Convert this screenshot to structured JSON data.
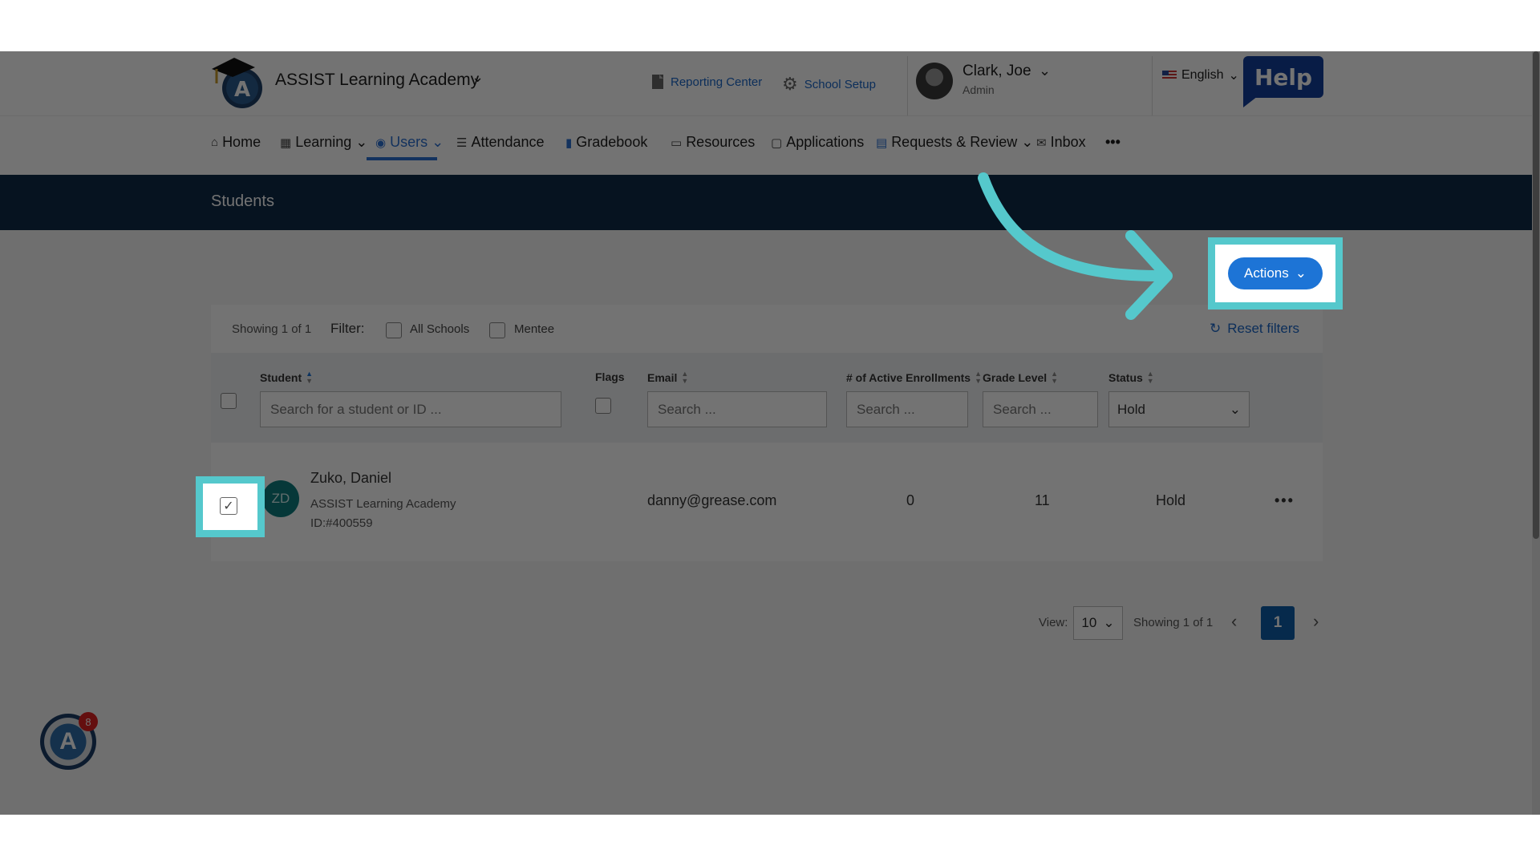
{
  "header": {
    "school_name": "ASSIST Learning Academy",
    "reporting_center": "Reporting Center",
    "school_setup": "School Setup",
    "user_name": "Clark, Joe",
    "user_role": "Admin",
    "language": "English",
    "help": "Help"
  },
  "nav": {
    "items": [
      {
        "label": "Home",
        "icon": "house-icon"
      },
      {
        "label": "Learning",
        "icon": "grid-icon"
      },
      {
        "label": "Users",
        "icon": "user-circle-icon"
      },
      {
        "label": "Attendance",
        "icon": "bars-icon"
      },
      {
        "label": "Gradebook",
        "icon": "book-icon"
      },
      {
        "label": "Resources",
        "icon": "inbox-tray-icon"
      },
      {
        "label": "Applications",
        "icon": "chat-icon"
      },
      {
        "label": "Requests & Review",
        "icon": "clipboard-icon"
      },
      {
        "label": "Inbox",
        "icon": "envelope-icon"
      },
      {
        "label": "•••",
        "icon": "more-icon"
      }
    ],
    "active": "Users"
  },
  "page": {
    "title": "Students",
    "actions_label": "Actions"
  },
  "filters": {
    "summary": "Showing 1 of 1",
    "label": "Filter:",
    "all_schools": "All Schools",
    "mentee": "Mentee",
    "reset": "Reset filters"
  },
  "table": {
    "columns": {
      "student": "Student",
      "flags": "Flags",
      "email": "Email",
      "enrollments": "# of Active Enrollments",
      "grade": "Grade Level",
      "status": "Status"
    },
    "placeholders": {
      "student": "Search for a student or ID ...",
      "email": "Search ...",
      "enrollments": "Search ...",
      "grade": "Search ..."
    },
    "status_filter": "Hold",
    "rows": [
      {
        "initials": "ZD",
        "name": "Zuko, Daniel",
        "school": "ASSIST Learning Academy",
        "id": "ID:#400559",
        "email": "danny@grease.com",
        "enrollments": "0",
        "grade": "11",
        "status": "Hold",
        "more": "•••"
      }
    ]
  },
  "pagination": {
    "view_label": "View:",
    "view_value": "10",
    "summary": "Showing 1 of 1",
    "page": "1"
  },
  "chat": {
    "badge": "8"
  },
  "colors": {
    "brand_dark": "#0e2a47",
    "accent": "#1d74d6",
    "highlight": "#55c8cc",
    "help": "#123e9c"
  }
}
